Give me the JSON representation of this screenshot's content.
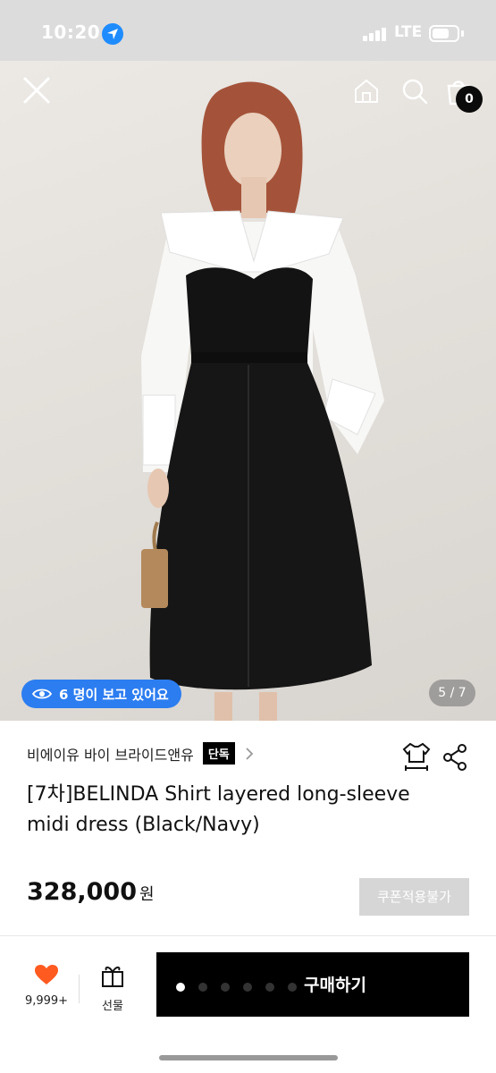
{
  "status_bar": {
    "time": "10:20",
    "network": "LTE"
  },
  "hero": {
    "viewers_text": "6 명이 보고 있어요",
    "page_counter": "5 / 7",
    "cart_count": "0"
  },
  "product": {
    "brand": "비에이유 바이 브라이드앤유",
    "exclusive_tag": "단독",
    "title": "[7차]BELINDA Shirt layered long-sleeve midi dress (Black/Navy)",
    "price": "328,000",
    "currency": "원",
    "coupon_label": "쿠폰적용불가"
  },
  "bottom_bar": {
    "like_count": "9,999+",
    "gift_label": "선물",
    "buy_label": "구매하기",
    "carousel": {
      "total": 6,
      "active": 1
    }
  },
  "colors": {
    "accent_blue": "#2c7df0",
    "like_orange": "#ff5a1f",
    "buy_black": "#000000"
  },
  "icons": [
    "close-icon",
    "home-icon",
    "search-icon",
    "cart-icon",
    "eye-icon",
    "chevron-right-icon",
    "size-guide-icon",
    "share-icon",
    "heart-icon",
    "gift-icon"
  ]
}
